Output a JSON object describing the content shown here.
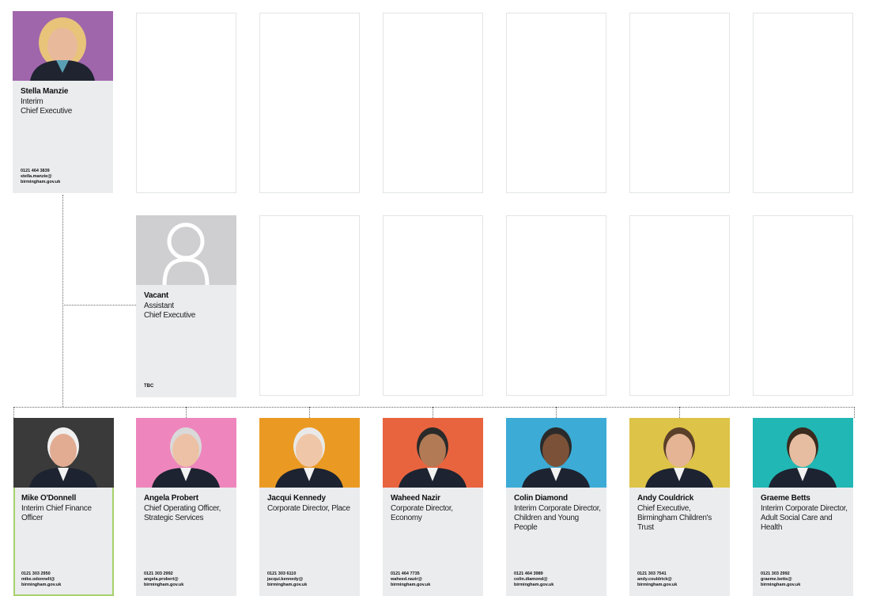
{
  "top_card": {
    "name": "Stella Manzie",
    "role_line1": "Interim",
    "role_line2": "Chief Executive",
    "phone": "0121 464 3839",
    "email_line1": "stella.manzie@",
    "email_line2": "birmingham.gov.uk",
    "photo_bg": "#a066ac"
  },
  "vacant_card": {
    "name": "Vacant",
    "role_line1": "Assistant",
    "role_line2": "Chief Executive",
    "contact": "TBC",
    "photo_bg": "#cfcfd1"
  },
  "directors": [
    {
      "name": "Mike O'Donnell",
      "role": "Interim Chief Finance Officer",
      "phone": "0121 303 2950",
      "email1": "mike.odonnell@",
      "email2": "birmingham.gov.uk",
      "bg": "#3a3a3a"
    },
    {
      "name": "Angela Probert",
      "role": "Chief Operating Officer, Strategic Services",
      "phone": "0121 303 2992",
      "email1": "angela.probert@",
      "email2": "birmingham.gov.uk",
      "bg": "#ee86bd"
    },
    {
      "name": "Jacqui Kennedy",
      "role": "Corporate Director, Place",
      "phone": "0121 303 6110",
      "email1": "jacqui.kennedy@",
      "email2": "birmingham.gov.uk",
      "bg": "#ea9a23"
    },
    {
      "name": "Waheed Nazir",
      "role": "Corporate Director, Economy",
      "phone": "0121 464 7735",
      "email1": "waheed.nazir@",
      "email2": "birmingham.gov.uk",
      "bg": "#e8643f"
    },
    {
      "name": "Colin Diamond",
      "role": "Interim Corporate Director, Children and Young People",
      "phone": "0121 464 3989",
      "email1": "colin.diamond@",
      "email2": "birmingham.gov.uk",
      "bg": "#3cabd6"
    },
    {
      "name": "Andy Couldrick",
      "role": "Chief Executive, Birmingham Children's Trust",
      "phone": "0121 303 7541",
      "email1": "andy.couldrick@",
      "email2": "birmingham.gov.uk",
      "bg": "#ddc347"
    },
    {
      "name": "Graeme Betts",
      "role": "Interim Corporate Director, Adult Social Care and Health",
      "phone": "0121 303 2992",
      "email1": "graeme.betts@",
      "email2": "birmingham.gov.uk",
      "bg": "#21b7b4"
    }
  ]
}
